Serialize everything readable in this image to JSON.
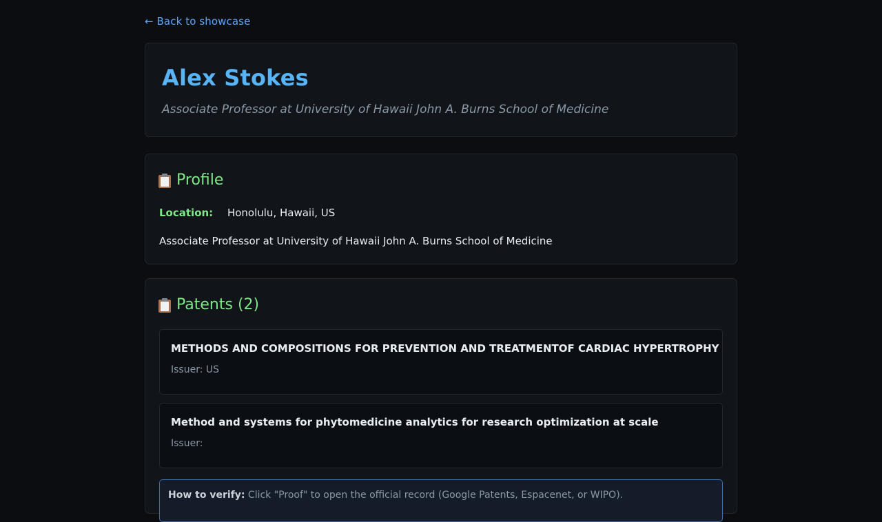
{
  "nav": {
    "back_label": "← Back to showcase"
  },
  "person": {
    "name": "Alex Stokes",
    "headline": "Associate Professor at University of Hawaii John A. Burns School of Medicine"
  },
  "profile": {
    "title": "Profile",
    "icon": "clipboard-icon",
    "location_label": "Location:",
    "location_value": "Honolulu, Hawaii, US",
    "bio": "Associate Professor at University of Hawaii John A. Burns School of Medicine"
  },
  "patents": {
    "title": "Patents (2)",
    "icon": "clipboard-icon",
    "items": [
      {
        "title": "METHODS AND COMPOSITIONS FOR PREVENTION AND TREATMENTOF CARDIAC HYPERTROPHY",
        "issuer": "Issuer: US"
      },
      {
        "title": "Method and systems for phytomedicine analytics for research optimization at scale",
        "issuer": "Issuer:"
      }
    ],
    "verify_label": "How to verify:",
    "verify_text": "Click \"Proof\" to open the official record (Google Patents, Espacenet, or WIPO)."
  },
  "colors": {
    "background": "#0b0d11",
    "card": "#111419",
    "accent_blue": "#58b4f5",
    "link_blue": "#58a6ff",
    "accent_green": "#7ee787",
    "muted": "#8b98a5"
  }
}
